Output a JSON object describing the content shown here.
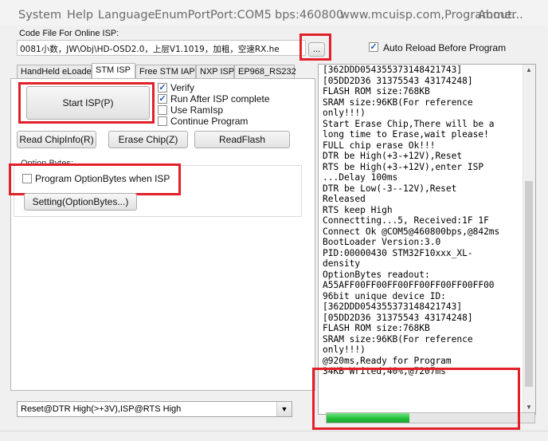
{
  "menubar": {
    "items": [
      "System",
      "Help",
      "Language",
      "EnumPort",
      "Port:COM5",
      "bps:460800",
      "www.mcuisp.com,Programmer",
      "About..."
    ]
  },
  "code_file": {
    "label": "Code File For Online ISP:",
    "path": "0081小数，JW\\Obj\\HD-OSD2.0，上层V1.1019，加粗，空速RX.he",
    "browse_label": "...",
    "auto_reload_label": "Auto Reload Before Program",
    "auto_reload_checked": true
  },
  "tabs": [
    "HandHeld eLoader",
    "STM ISP",
    "Free STM IAP",
    "NXP ISP",
    "EP968_RS232"
  ],
  "stm_isp": {
    "start_label": "Start ISP(P)",
    "verify_label": "Verify",
    "run_after_label": "Run After ISP complete",
    "use_ramisp_label": "Use RamIsp",
    "continue_label": "Continue Program",
    "read_chipinfo_label": "Read ChipInfo(R)",
    "erase_chip_label": "Erase Chip(Z)",
    "readflash_label": "ReadFlash",
    "option_bytes_group": "Option Bytes:",
    "program_option_label": "Program OptionBytes when ISP",
    "setting_label": "Setting(OptionBytes...)"
  },
  "reset_select": {
    "value": "Reset@DTR High(>+3V),ISP@RTS High"
  },
  "log": {
    "lines": [
      "[362DDD054355373148421743]",
      "[05DD2D36 31375543 43174248]",
      "FLASH ROM size:768KB",
      "SRAM size:96KB(For reference",
      "only!!!)",
      "Start Erase Chip,There will be a",
      "long time to Erase,wait please!",
      "FULL chip erase Ok!!!",
      "DTR be High(+3-+12V),Reset",
      "RTS be High(+3-+12V),enter ISP",
      "...Delay 100ms",
      "DTR be Low(-3--12V),Reset",
      "Released",
      "RTS keep High",
      "Connectting...5, Received:1F 1F",
      "Connect Ok @COM5@460800bps,@842ms",
      "BootLoader Version:3.0",
      "PID:00000430  STM32F10xxx_XL-",
      "density",
      "OptionBytes readout:",
      "A55AFF00FF00FF00FF00FF00FF00FF00",
      "96bit unique device ID:",
      "[362DDD054355373148421743]",
      "[05DD2D36 31375543 43174248]",
      "FLASH ROM size:768KB",
      "SRAM size:96KB(For reference",
      "only!!!)",
      "@920ms,Ready for Program",
      "34KB Writed,40%,@7207ms"
    ]
  },
  "progress": {
    "percent": 40
  },
  "colors": {
    "annotation_red": "#e2202a",
    "progress_green": "#22c43a"
  }
}
